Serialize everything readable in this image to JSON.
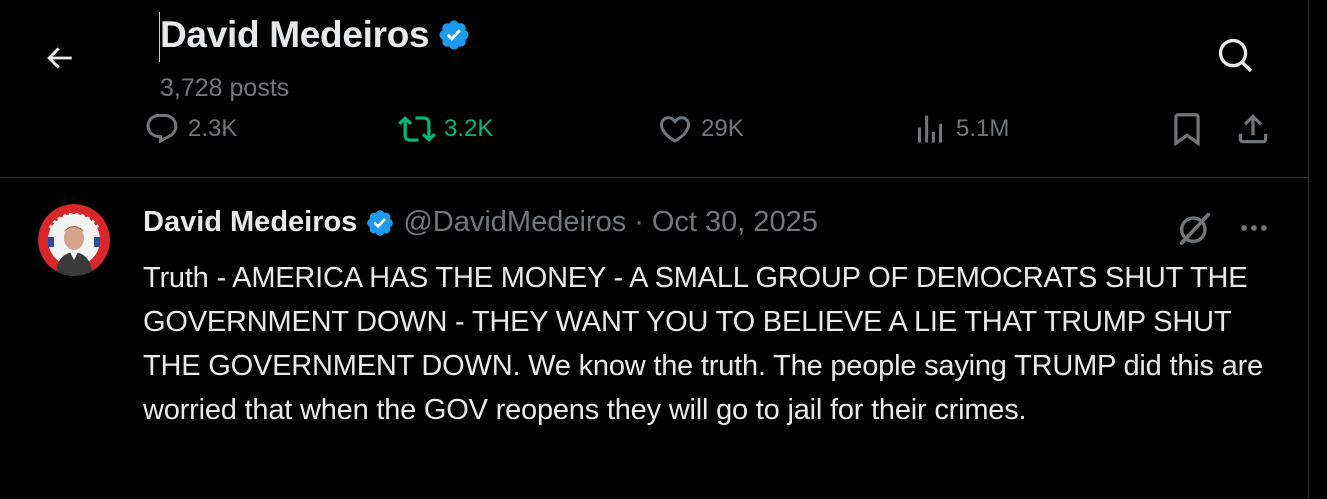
{
  "header": {
    "name": "David Medeiros",
    "posts": "3,728 posts",
    "back_icon": "arrow-left-icon",
    "search_icon": "search-icon",
    "verified_icon": "verified-badge-icon"
  },
  "actions": {
    "replies": "2.3K",
    "reposts": "3.2K",
    "likes": "29K",
    "views": "5.1M",
    "bookmark_icon": "bookmark-icon",
    "share_icon": "share-icon"
  },
  "tweet": {
    "name": "David Medeiros",
    "handle": "@DavidMedeiros",
    "separator": "·",
    "date": "Oct 30, 2025",
    "text": "Truth - AMERICA HAS THE MONEY - A SMALL GROUP OF DEMOCRATS SHUT THE GOVERNMENT DOWN - THEY WANT YOU TO BELIEVE A LIE THAT TRUMP SHUT THE GOVERNMENT DOWN. We know the truth. The people saying TRUMP did this are worried that when the GOV reopens they will go to jail for their crimes.",
    "grok_icon": "grok-icon",
    "more_icon": "more-icon"
  },
  "colors": {
    "background": "#000000",
    "text": "#e7e9ea",
    "muted": "#71767b",
    "verified": "#1d9bf0",
    "repost": "#00ba7c",
    "border": "#2f3336"
  }
}
